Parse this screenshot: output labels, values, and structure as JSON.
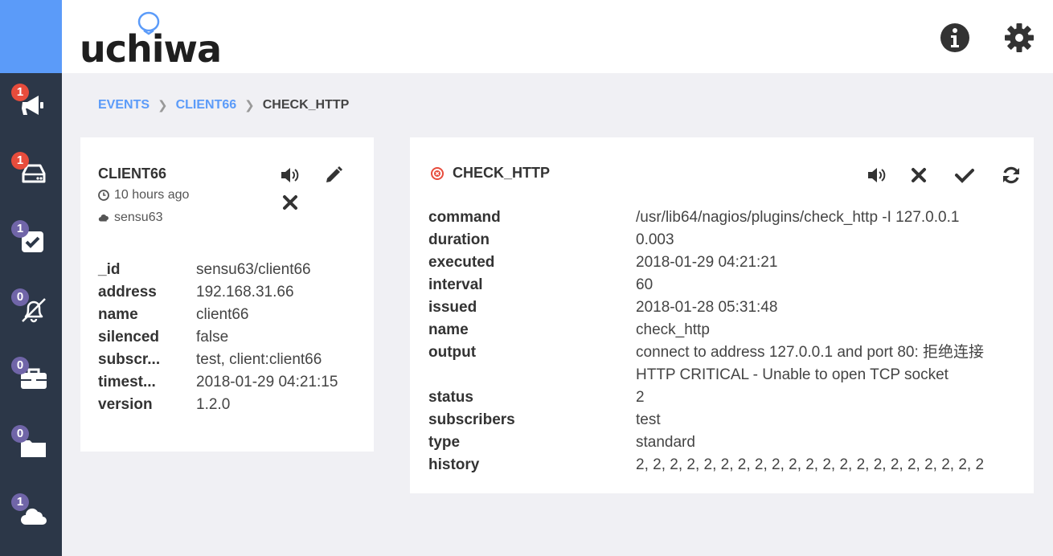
{
  "sidebar": {
    "items": [
      {
        "icon": "megaphone-icon",
        "badge": "1",
        "badge_color": "#e74c3c"
      },
      {
        "icon": "hard-drive-icon",
        "badge": "1",
        "badge_color": "#e74c3c"
      },
      {
        "icon": "check-square-icon",
        "badge": "1",
        "badge_color": "#7065a8"
      },
      {
        "icon": "bell-slash-icon",
        "badge": "0",
        "badge_color": "#7065a8"
      },
      {
        "icon": "briefcase-icon",
        "badge": "0",
        "badge_color": "#7065a8"
      },
      {
        "icon": "folder-icon",
        "badge": "0",
        "badge_color": "#7065a8"
      },
      {
        "icon": "cloud-icon",
        "badge": "1",
        "badge_color": "#7065a8"
      }
    ]
  },
  "header": {
    "logo_text": "uchiwa",
    "info_icon": "info-circle-icon",
    "settings_icon": "gear-icon"
  },
  "breadcrumb": {
    "events": "EVENTS",
    "client": "CLIENT66",
    "current": "CHECK_HTTP"
  },
  "client": {
    "title": "CLIENT66",
    "last_seen": "10 hours ago",
    "datacenter": "sensu63",
    "fields": [
      {
        "key": "_id",
        "value": "sensu63/client66"
      },
      {
        "key": "address",
        "value": "192.168.31.66"
      },
      {
        "key": "name",
        "value": "client66"
      },
      {
        "key": "silenced",
        "value": "false"
      },
      {
        "key": "subscr...",
        "value": "test, client:client66"
      },
      {
        "key": "timest...",
        "value": "2018-01-29 04:21:15"
      },
      {
        "key": "version",
        "value": "1.2.0"
      }
    ]
  },
  "check": {
    "title": "CHECK_HTTP",
    "status_color": "#e74c3c",
    "fields": [
      {
        "key": "command",
        "value": "/usr/lib64/nagios/plugins/check_http -I 127.0.0.1"
      },
      {
        "key": "duration",
        "value": "0.003"
      },
      {
        "key": "executed",
        "value": "2018-01-29 04:21:21"
      },
      {
        "key": "interval",
        "value": "60"
      },
      {
        "key": "issued",
        "value": "2018-01-28 05:31:48"
      },
      {
        "key": "name",
        "value": "check_http"
      },
      {
        "key": "output",
        "value": "connect to address 127.0.0.1 and port 80: 拒绝连接"
      },
      {
        "key": "",
        "value": "HTTP CRITICAL - Unable to open TCP socket"
      },
      {
        "key": "status",
        "value": "2"
      },
      {
        "key": "subscribers",
        "value": "test"
      },
      {
        "key": "type",
        "value": "standard"
      },
      {
        "key": "history",
        "value": "2, 2, 2, 2, 2, 2, 2, 2, 2, 2, 2, 2, 2, 2, 2, 2, 2, 2, 2, 2, 2"
      }
    ]
  }
}
